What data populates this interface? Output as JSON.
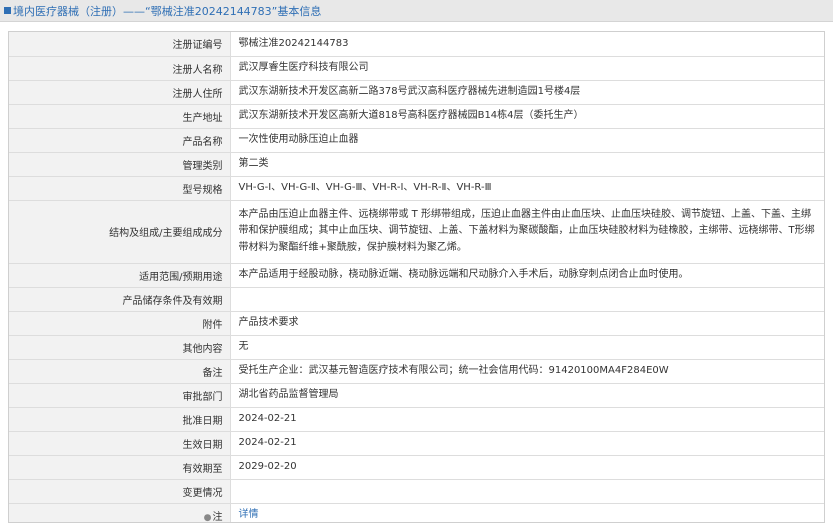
{
  "header": {
    "title": "境内医疗器械（注册）——“鄂械注准20242144783”基本信息"
  },
  "rows": [
    {
      "label": "注册证编号",
      "value": "鄂械注准20242144783"
    },
    {
      "label": "注册人名称",
      "value": "武汉厚睿生医疗科技有限公司"
    },
    {
      "label": "注册人住所",
      "value": "武汉东湖新技术开发区高新二路378号武汉高科医疗器械先进制造园1号楼4层"
    },
    {
      "label": "生产地址",
      "value": "武汉东湖新技术开发区高新大道818号高科医疗器械园B14栋4层（委托生产）"
    },
    {
      "label": "产品名称",
      "value": "一次性使用动脉压迫止血器"
    },
    {
      "label": "管理类别",
      "value": "第二类"
    },
    {
      "label": "型号规格",
      "value": "VH-G-Ⅰ、VH-G-Ⅱ、VH-G-Ⅲ、VH-R-Ⅰ、VH-R-Ⅱ、VH-R-Ⅲ"
    },
    {
      "label": "结构及组成/主要组成成分",
      "value": "本产品由压迫止血器主件、远桡绑带或 T 形绑带组成，压迫止血器主件由止血压块、止血压块硅胶、调节旋钮、上盖、下盖、主绑带和保护膜组成；其中止血压块、调节旋钮、上盖、下盖材料为聚碳酸酯，止血压块硅胶材料为硅橡胶，主绑带、远桡绑带、T形绑带材料为聚酯纤维+聚酰胺，保护膜材料为聚乙烯。"
    },
    {
      "label": "适用范围/预期用途",
      "value": "本产品适用于经股动脉，桡动脉近端、桡动脉远端和尺动脉介入手术后，动脉穿刺点闭合止血时使用。"
    },
    {
      "label": "产品储存条件及有效期",
      "value": ""
    },
    {
      "label": "附件",
      "value": "产品技术要求"
    },
    {
      "label": "其他内容",
      "value": "无"
    },
    {
      "label": "备注",
      "value": "受托生产企业：武汉基元智造医疗技术有限公司；统一社会信用代码：91420100MA4F284E0W"
    },
    {
      "label": "审批部门",
      "value": "湖北省药品监督管理局"
    },
    {
      "label": "批准日期",
      "value": "2024-02-21"
    },
    {
      "label": "生效日期",
      "value": "2024-02-21"
    },
    {
      "label": "有效期至",
      "value": "2029-02-20"
    },
    {
      "label": "变更情况",
      "value": ""
    }
  ],
  "note": {
    "label": "注",
    "pin_icon": "pin-icon",
    "link_text": "详情"
  }
}
